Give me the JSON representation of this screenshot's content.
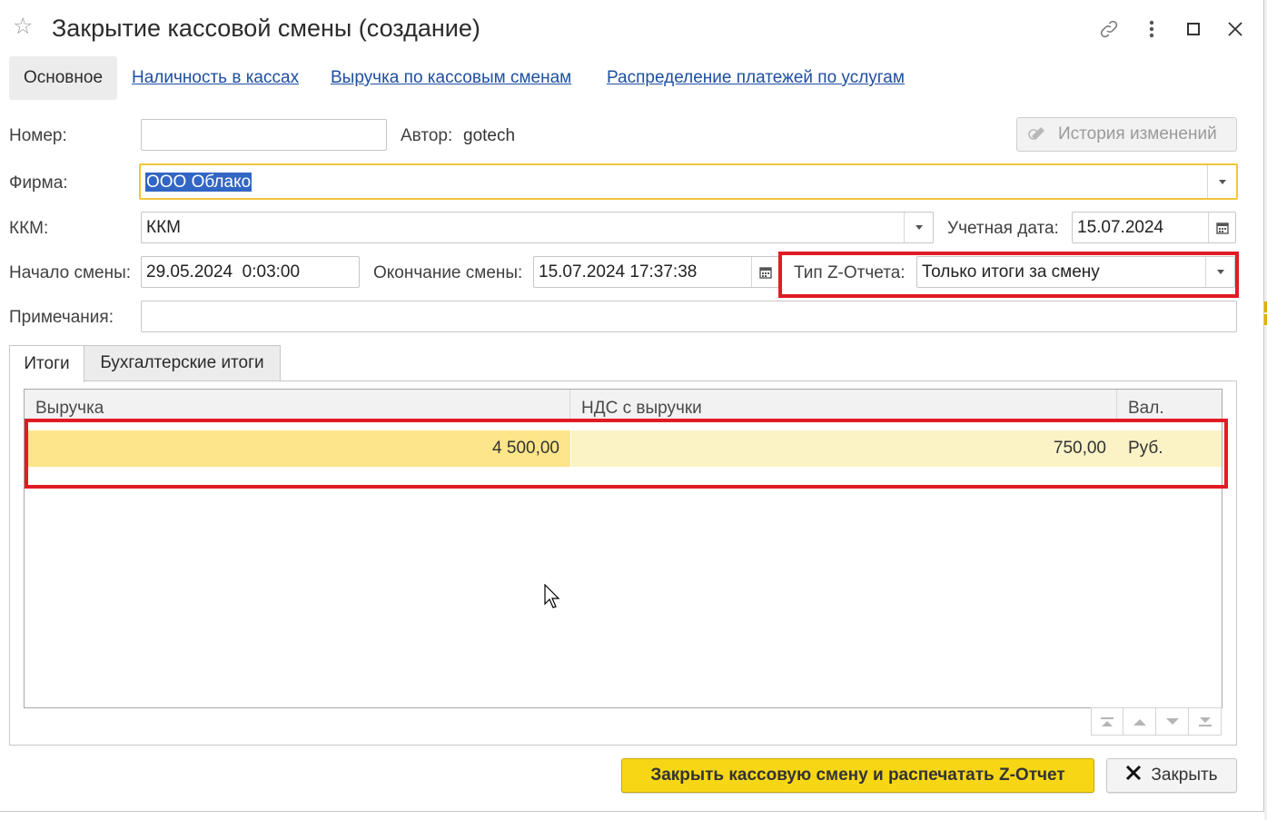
{
  "window": {
    "title": "Закрытие кассовой смены (создание)"
  },
  "icons": {
    "favorite": "star-icon",
    "link": "link-icon",
    "more": "more-vertical-icon",
    "maximize": "maximize-icon",
    "close": "close-icon"
  },
  "nav_tabs": [
    {
      "label": "Основное",
      "active": true
    },
    {
      "label": "Наличность в кассах",
      "active": false
    },
    {
      "label": "Выручка по кассовым сменам",
      "active": false
    },
    {
      "label": "Распределение платежей по услугам",
      "active": false
    }
  ],
  "form": {
    "number_label": "Номер:",
    "number_value": "",
    "author_label": "Автор:",
    "author_value": "gotech",
    "history_button": "История изменений",
    "firm_label": "Фирма:",
    "firm_value": "ООО Облако",
    "kkm_label": "ККМ:",
    "kkm_value": "ККМ",
    "accounting_date_label": "Учетная дата:",
    "accounting_date_value": "15.07.2024",
    "shift_start_label": "Начало смены:",
    "shift_start_value": "29.05.2024  0:03:00",
    "shift_end_label": "Окончание смены:",
    "shift_end_value": "15.07.2024 17:37:38",
    "z_report_type_label": "Тип Z-Отчета:",
    "z_report_type_value": "Только итоги за смену",
    "notes_label": "Примечания:",
    "notes_value": ""
  },
  "inner_tabs": [
    {
      "label": "Итоги",
      "active": true
    },
    {
      "label": "Бухгалтерские итоги",
      "active": false
    }
  ],
  "totals_table": {
    "columns": [
      "Выручка",
      "НДС с выручки",
      "Вал."
    ],
    "rows": [
      [
        "4 500,00",
        "750,00",
        "Руб."
      ]
    ]
  },
  "buttons": {
    "close_shift_print": "Закрыть кассовую смену и распечатать Z-Отчет",
    "close": "Закрыть"
  },
  "colors": {
    "link": "#1e4fa1",
    "highlight_border": "#e11b24",
    "primary_button": "#f7d715",
    "selected_row": "#fbf2c6",
    "selected_cell": "#fde68a",
    "text_selection": "#3166c4"
  }
}
